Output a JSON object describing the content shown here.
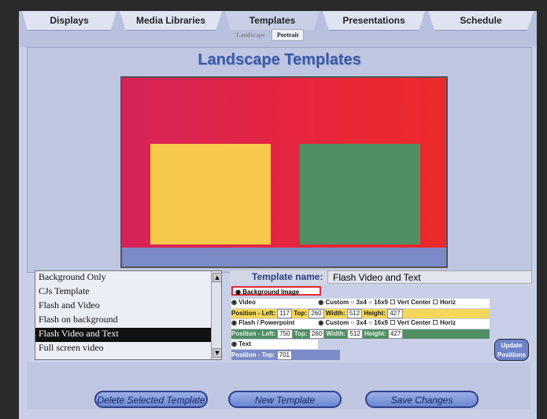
{
  "tabs": [
    {
      "label": "Displays",
      "active": false
    },
    {
      "label": "Media Libraries",
      "active": false
    },
    {
      "label": "Templates",
      "active": true
    },
    {
      "label": "Presentations",
      "active": false
    },
    {
      "label": "Schedule",
      "active": false
    }
  ],
  "subtabs": [
    {
      "label": "Landscape",
      "selected": false
    },
    {
      "label": "Portrait",
      "selected": true
    }
  ],
  "page_title": "Landscape Templates",
  "templates_list": [
    "Background Only",
    "CJs Template",
    "Flash and Video",
    "Flash on background",
    "Flash Video and Text",
    "Full screen video"
  ],
  "selected_template": "Flash Video and Text",
  "template_name": {
    "label": "Template name:",
    "value": "Flash Video and Text"
  },
  "options": {
    "background_image": "Background Image",
    "video": {
      "label": "Video",
      "custom": "Custom",
      "r3x4": "3x4",
      "r16x9": "16x9",
      "vert_center": "Vert Center",
      "horiz": "Horiz",
      "position_label": "Position - Left:",
      "left": "117",
      "top_label": "Top:",
      "top": "260",
      "width_label": "Width:",
      "width": "512",
      "height_label": "Height:",
      "height": "427"
    },
    "flash": {
      "label": "Flash / Powerpoint",
      "custom": "Custom",
      "r3x4": "3x4",
      "r16x9": "16x9",
      "vert_center": "Vert Center",
      "horiz": "Horiz",
      "position_label": "Position - Left:",
      "left": "750",
      "top_label": "Top:",
      "top": "260",
      "width_label": "Width:",
      "width": "512",
      "height_label": "Height:",
      "height": "427"
    },
    "text": {
      "label": "Text",
      "position_label": "Position - Top:",
      "top": "701"
    }
  },
  "update_positions": "Update Positions",
  "buttons": {
    "delete": "Delete Selected Template",
    "new": "New Template",
    "save": "Save Changes"
  },
  "colors": {
    "preview_red": "#e8263b",
    "video_yellow": "#f6c94a",
    "flash_green": "#4f8f63",
    "text_blue": "#7c8bc8"
  }
}
